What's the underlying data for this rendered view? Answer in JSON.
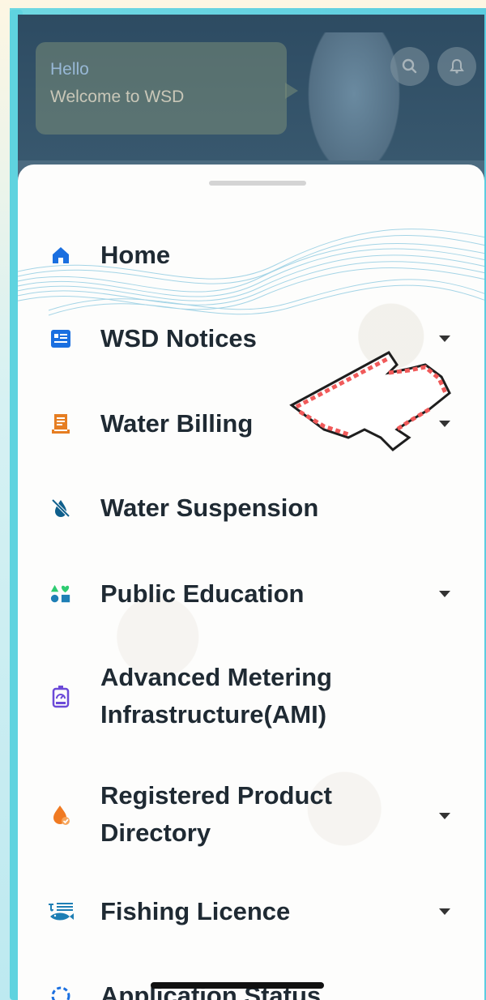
{
  "header": {
    "hello": "Hello",
    "welcome": "Welcome to WSD"
  },
  "menu": {
    "items": [
      {
        "label": "Home",
        "icon": "home-icon",
        "has_chevron": false
      },
      {
        "label": "WSD Notices",
        "icon": "notices-icon",
        "has_chevron": true
      },
      {
        "label": "Water Billing",
        "icon": "bill-icon",
        "has_chevron": true
      },
      {
        "label": "Water Suspension",
        "icon": "water-suspension-icon",
        "has_chevron": false
      },
      {
        "label": "Public Education",
        "icon": "education-shapes-icon",
        "has_chevron": true
      },
      {
        "label": "Advanced Metering",
        "label2": "Infrastructure(AMI)",
        "icon": "meter-icon",
        "has_chevron": false
      },
      {
        "label": "Registered Product",
        "label2": "Directory",
        "icon": "product-drop-icon",
        "has_chevron": true
      },
      {
        "label": "Fishing Licence",
        "icon": "fish-icon",
        "has_chevron": true
      },
      {
        "label": "Application Status",
        "icon": "status-spinner-icon",
        "has_chevron": false
      }
    ]
  },
  "colors": {
    "frame": "#5fd3df",
    "header_bg": "#2d4b62",
    "drawer_bg": "#fdfdfc",
    "label": "#1f2a33",
    "accent_blue": "#1a6fe0",
    "cursor_red": "#f05a5a"
  }
}
